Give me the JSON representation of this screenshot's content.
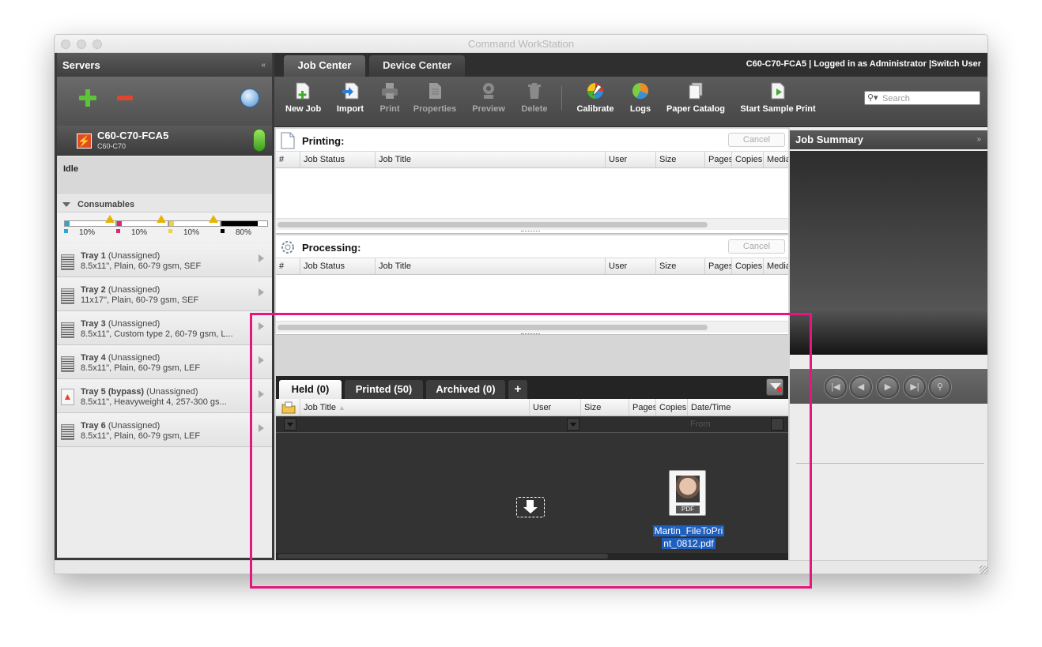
{
  "window": {
    "title": "Command WorkStation"
  },
  "sidebar": {
    "title": "Servers",
    "collapse_icon": "«",
    "server": {
      "name": "C60-C70-FCA5",
      "model": "C60-C70",
      "icon_glyph": "⚡",
      "status": "Idle"
    },
    "consumables": {
      "title": "Consumables",
      "items": [
        {
          "color": "cyan",
          "hex": "#29a7d6",
          "level": 10,
          "label": "10%",
          "warning": true
        },
        {
          "color": "magenta",
          "hex": "#e0247b",
          "level": 10,
          "label": "10%",
          "warning": true
        },
        {
          "color": "yellow",
          "hex": "#f2d23a",
          "level": 10,
          "label": "10%",
          "warning": true
        },
        {
          "color": "black",
          "hex": "#000000",
          "level": 80,
          "label": "80%",
          "warning": false
        }
      ]
    },
    "trays": [
      {
        "name": "Tray 1",
        "status": "(Unassigned)",
        "desc": "8.5x11\", Plain, 60-79 gsm, SEF",
        "alert": false
      },
      {
        "name": "Tray 2",
        "status": "(Unassigned)",
        "desc": "11x17\", Plain, 60-79 gsm, SEF",
        "alert": false
      },
      {
        "name": "Tray 3",
        "status": "(Unassigned)",
        "desc": "8.5x11\", Custom type 2, 60-79 gsm, L...",
        "alert": false
      },
      {
        "name": "Tray 4",
        "status": "(Unassigned)",
        "desc": "8.5x11\", Plain, 60-79 gsm, LEF",
        "alert": false
      },
      {
        "name": "Tray 5 (bypass)",
        "status": "(Unassigned)",
        "desc": "8.5x11\", Heavyweight 4, 257-300 gs...",
        "alert": true
      },
      {
        "name": "Tray 6",
        "status": "(Unassigned)",
        "desc": "8.5x11\", Plain, 60-79 gsm, LEF",
        "alert": false
      }
    ]
  },
  "tabs": {
    "job_center": "Job Center",
    "device_center": "Device Center"
  },
  "login_info": "C60-C70-FCA5 | Logged in as Administrator |Switch User",
  "toolbar": {
    "new_job": "New Job",
    "import": "Import",
    "print": "Print",
    "properties": "Properties",
    "preview": "Preview",
    "delete": "Delete",
    "calibrate": "Calibrate",
    "logs": "Logs",
    "paper_catalog": "Paper Catalog",
    "start_sample_print": "Start Sample Print",
    "search_placeholder": "Search"
  },
  "printing": {
    "title": "Printing:",
    "cancel": "Cancel",
    "columns": [
      "#",
      "Job Status",
      "Job Title",
      "User",
      "Size",
      "Pages",
      "Copies",
      "Media"
    ]
  },
  "processing": {
    "title": "Processing:",
    "cancel": "Cancel",
    "columns": [
      "#",
      "Job Status",
      "Job Title",
      "User",
      "Size",
      "Pages",
      "Copies",
      "Media"
    ]
  },
  "held": {
    "tabs": {
      "held": "Held (0)",
      "printed": "Printed (50)",
      "archived": "Archived (0)",
      "add": "+"
    },
    "columns": {
      "job_title": "Job Title",
      "user": "User",
      "size": "Size",
      "pages": "Pages",
      "copies": "Copies",
      "datetime": "Date/Time"
    },
    "filter_from": "From",
    "file": {
      "name_line1": "Martin_FileToPri",
      "name_line2": "nt_0812.pdf",
      "badge": "PDF"
    }
  },
  "summary": {
    "title": "Job Summary",
    "collapse_icon": "»",
    "nav_icons": [
      "first-icon",
      "prev-icon",
      "next-icon",
      "last-icon",
      "zoom-icon"
    ]
  },
  "colors": {
    "highlight": "#e5177e",
    "selection": "#1e5fbf",
    "add": "#5dc43a",
    "remove": "#e0442f"
  }
}
